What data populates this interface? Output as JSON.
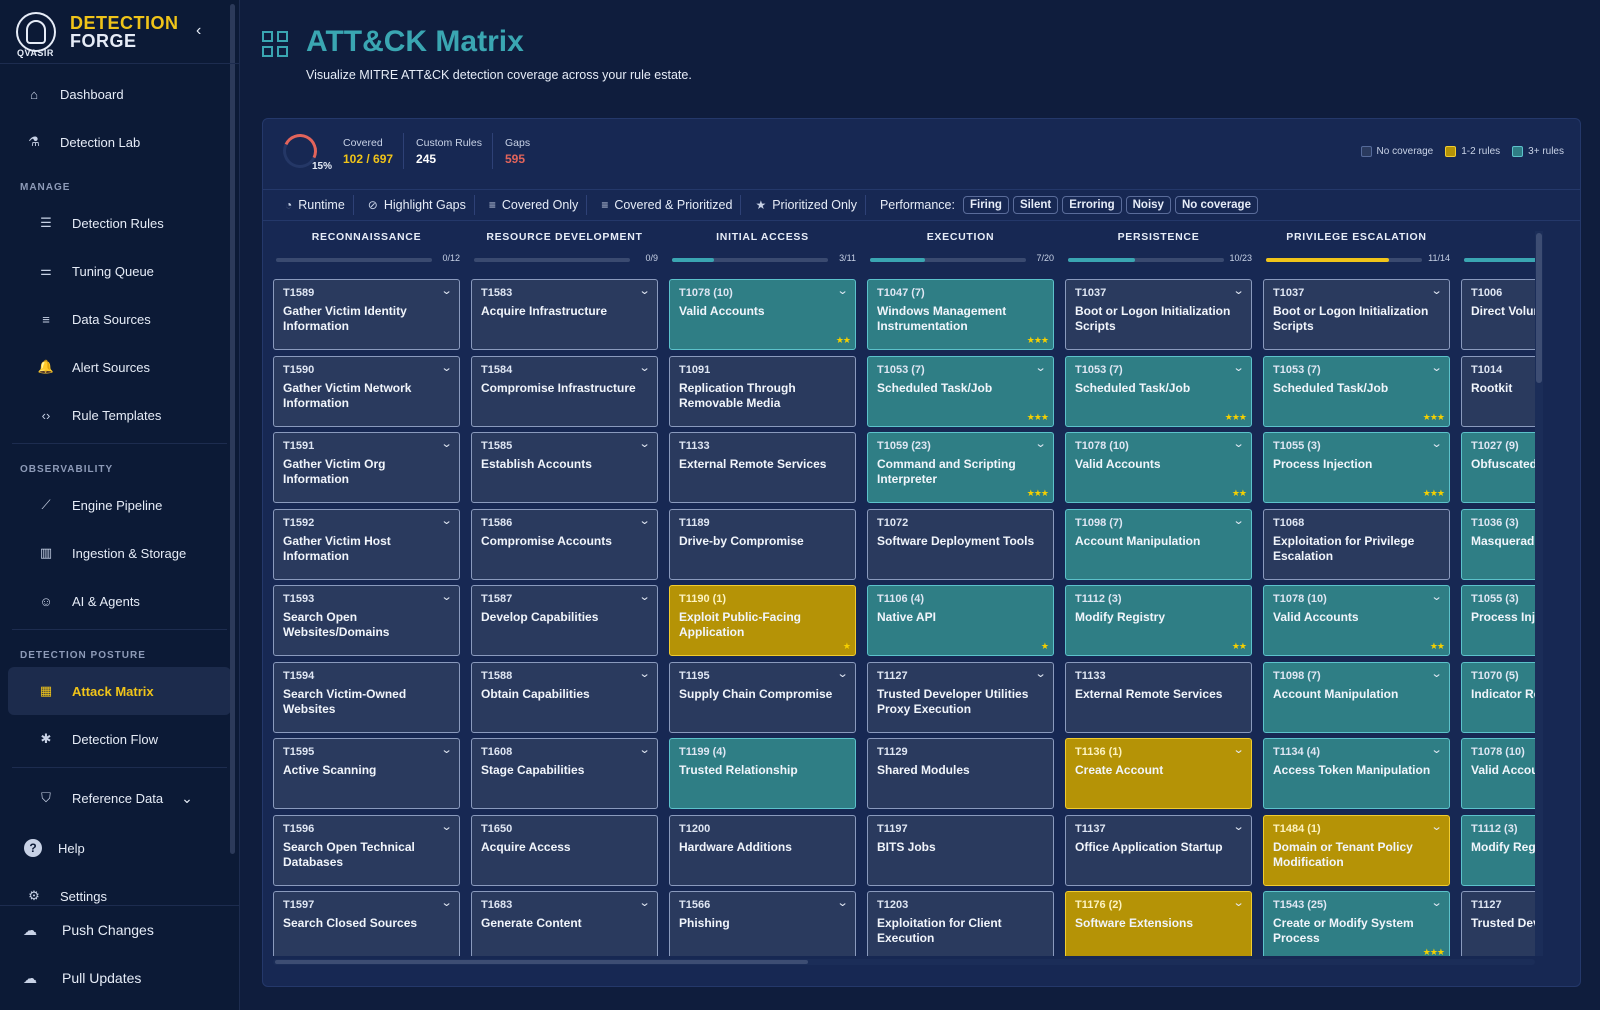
{
  "brand": {
    "line1": "DETECTION",
    "line2": "FORGE",
    "sub": "QVASIR",
    "collapse": "‹"
  },
  "nav": {
    "top": [
      {
        "key": "dashboard",
        "label": "Dashboard",
        "icon": "home-icon",
        "glyph": "⌂"
      },
      {
        "key": "detection-lab",
        "label": "Detection Lab",
        "icon": "microscope-icon",
        "glyph": "⚗"
      }
    ],
    "manage_title": "MANAGE",
    "manage": [
      {
        "key": "detection-rules",
        "label": "Detection Rules",
        "icon": "rules-icon",
        "glyph": "☰"
      },
      {
        "key": "tuning-queue",
        "label": "Tuning Queue",
        "icon": "tune-icon",
        "glyph": "⚌"
      },
      {
        "key": "data-sources",
        "label": "Data Sources",
        "icon": "list-icon",
        "glyph": "≡"
      },
      {
        "key": "alert-sources",
        "label": "Alert Sources",
        "icon": "bell-icon",
        "glyph": "🔔"
      },
      {
        "key": "rule-templates",
        "label": "Rule Templates",
        "icon": "code-icon",
        "glyph": "‹›"
      }
    ],
    "observability_title": "OBSERVABILITY",
    "observability": [
      {
        "key": "engine-pipeline",
        "label": "Engine Pipeline",
        "icon": "trend-icon",
        "glyph": "⟋"
      },
      {
        "key": "ingestion-storage",
        "label": "Ingestion & Storage",
        "icon": "bar-chart-icon",
        "glyph": "▥"
      },
      {
        "key": "ai-agents",
        "label": "AI & Agents",
        "icon": "robot-icon",
        "glyph": "☺"
      }
    ],
    "posture_title": "DETECTION POSTURE",
    "posture": [
      {
        "key": "attack-matrix",
        "label": "Attack Matrix",
        "icon": "grid-icon",
        "glyph": "▦",
        "active": true
      },
      {
        "key": "detection-flow",
        "label": "Detection Flow",
        "icon": "flow-icon",
        "glyph": "✱"
      }
    ],
    "reference": {
      "label": "Reference Data",
      "glyph": "⛉",
      "chevron": "⌄"
    },
    "help": {
      "label": "Help",
      "glyph": "?"
    },
    "settings": {
      "label": "Settings",
      "glyph": "⚙"
    },
    "push": {
      "label": "Push Changes",
      "glyph": "☁"
    },
    "pull": {
      "label": "Pull Updates",
      "glyph": "☁"
    }
  },
  "header": {
    "title": "ATT&CK Matrix",
    "subtitle": "Visualize MITRE ATT&CK detection coverage across your rule estate."
  },
  "stats": {
    "percent": "15%",
    "covered_label": "Covered",
    "covered_value": "102 / 697",
    "custom_label": "Custom Rules",
    "custom_value": "245",
    "gaps_label": "Gaps",
    "gaps_value": "595"
  },
  "legend": [
    {
      "label": "No coverage",
      "color": "#2a3a5e"
    },
    {
      "label": "1-2 rules",
      "color": "#b59306"
    },
    {
      "label": "3+ rules",
      "color": "#2f7e85"
    }
  ],
  "toolbar": {
    "runtime": "Runtime",
    "highlight_gaps": "Highlight Gaps",
    "covered_only": "Covered Only",
    "covered_prioritized": "Covered & Prioritized",
    "prioritized_only": "Prioritized Only",
    "performance_label": "Performance:",
    "chips": [
      "Firing",
      "Silent",
      "Erroring",
      "Noisy",
      "No coverage"
    ]
  },
  "colors": {
    "accent": "#3aa6b2",
    "brand": "#f0c419",
    "teal": "#2f7e85",
    "yellow": "#b59306",
    "gap": "#e2645b"
  },
  "tactics": [
    {
      "name": "RECONNAISSANCE",
      "count": "0/12",
      "progress": 0,
      "bar": "#3aa6b2",
      "cells": [
        {
          "id": "T1589",
          "name": "Gather Victim Identity Information",
          "s": "none",
          "chev": true
        },
        {
          "id": "T1590",
          "name": "Gather Victim Network Information",
          "s": "none",
          "chev": true
        },
        {
          "id": "T1591",
          "name": "Gather Victim Org Information",
          "s": "none",
          "chev": true
        },
        {
          "id": "T1592",
          "name": "Gather Victim Host Information",
          "s": "none",
          "chev": true
        },
        {
          "id": "T1593",
          "name": "Search Open Websites/Domains",
          "s": "none",
          "chev": true
        },
        {
          "id": "T1594",
          "name": "Search Victim-Owned Websites",
          "s": "none",
          "chev": false
        },
        {
          "id": "T1595",
          "name": "Active Scanning",
          "s": "none",
          "chev": true
        },
        {
          "id": "T1596",
          "name": "Search Open Technical Databases",
          "s": "none",
          "chev": true
        },
        {
          "id": "T1597",
          "name": "Search Closed Sources",
          "s": "none",
          "chev": true
        }
      ]
    },
    {
      "name": "RESOURCE DEVELOPMENT",
      "count": "0/9",
      "progress": 0,
      "bar": "#3aa6b2",
      "cells": [
        {
          "id": "T1583",
          "name": "Acquire Infrastructure",
          "s": "none",
          "chev": true
        },
        {
          "id": "T1584",
          "name": "Compromise Infrastructure",
          "s": "none",
          "chev": true
        },
        {
          "id": "T1585",
          "name": "Establish Accounts",
          "s": "none",
          "chev": true
        },
        {
          "id": "T1586",
          "name": "Compromise Accounts",
          "s": "none",
          "chev": true
        },
        {
          "id": "T1587",
          "name": "Develop Capabilities",
          "s": "none",
          "chev": true
        },
        {
          "id": "T1588",
          "name": "Obtain Capabilities",
          "s": "none",
          "chev": true
        },
        {
          "id": "T1608",
          "name": "Stage Capabilities",
          "s": "none",
          "chev": true
        },
        {
          "id": "T1650",
          "name": "Acquire Access",
          "s": "none",
          "chev": false
        },
        {
          "id": "T1683",
          "name": "Generate Content",
          "s": "none",
          "chev": true
        }
      ]
    },
    {
      "name": "INITIAL ACCESS",
      "count": "3/11",
      "progress": 0.27,
      "bar": "#3aa6b2",
      "cells": [
        {
          "id": "T1078 (10)",
          "name": "Valid Accounts",
          "s": "teal",
          "chev": true,
          "stars": "★★"
        },
        {
          "id": "T1091",
          "name": "Replication Through Removable Media",
          "s": "none",
          "chev": false
        },
        {
          "id": "T1133",
          "name": "External Remote Services",
          "s": "none",
          "chev": false
        },
        {
          "id": "T1189",
          "name": "Drive-by Compromise",
          "s": "none",
          "chev": false
        },
        {
          "id": "T1190 (1)",
          "name": "Exploit Public-Facing Application",
          "s": "yellow",
          "chev": false,
          "stars": "★"
        },
        {
          "id": "T1195",
          "name": "Supply Chain Compromise",
          "s": "none",
          "chev": true
        },
        {
          "id": "T1199 (4)",
          "name": "Trusted Relationship",
          "s": "teal",
          "chev": false
        },
        {
          "id": "T1200",
          "name": "Hardware Additions",
          "s": "none",
          "chev": false
        },
        {
          "id": "T1566",
          "name": "Phishing",
          "s": "none",
          "chev": true
        }
      ]
    },
    {
      "name": "EXECUTION",
      "count": "7/20",
      "progress": 0.35,
      "bar": "#3aa6b2",
      "cells": [
        {
          "id": "T1047 (7)",
          "name": "Windows Management Instrumentation",
          "s": "teal",
          "chev": false,
          "stars": "★★★"
        },
        {
          "id": "T1053 (7)",
          "name": "Scheduled Task/Job",
          "s": "teal",
          "chev": true,
          "stars": "★★★"
        },
        {
          "id": "T1059 (23)",
          "name": "Command and Scripting Interpreter",
          "s": "teal",
          "chev": true,
          "stars": "★★★"
        },
        {
          "id": "T1072",
          "name": "Software Deployment Tools",
          "s": "none",
          "chev": false
        },
        {
          "id": "T1106 (4)",
          "name": "Native API",
          "s": "teal",
          "chev": false,
          "stars": "★"
        },
        {
          "id": "T1127",
          "name": "Trusted Developer Utilities Proxy Execution",
          "s": "none",
          "chev": true
        },
        {
          "id": "T1129",
          "name": "Shared Modules",
          "s": "none",
          "chev": false
        },
        {
          "id": "T1197",
          "name": "BITS Jobs",
          "s": "none",
          "chev": false
        },
        {
          "id": "T1203",
          "name": "Exploitation for Client Execution",
          "s": "none",
          "chev": false
        }
      ]
    },
    {
      "name": "PERSISTENCE",
      "count": "10/23",
      "progress": 0.43,
      "bar": "#3aa6b2",
      "cells": [
        {
          "id": "T1037",
          "name": "Boot or Logon Initialization Scripts",
          "s": "none",
          "chev": true
        },
        {
          "id": "T1053 (7)",
          "name": "Scheduled Task/Job",
          "s": "teal",
          "chev": true,
          "stars": "★★★"
        },
        {
          "id": "T1078 (10)",
          "name": "Valid Accounts",
          "s": "teal",
          "chev": true,
          "stars": "★★"
        },
        {
          "id": "T1098 (7)",
          "name": "Account Manipulation",
          "s": "teal",
          "chev": true
        },
        {
          "id": "T1112 (3)",
          "name": "Modify Registry",
          "s": "teal",
          "chev": false,
          "stars": "★★"
        },
        {
          "id": "T1133",
          "name": "External Remote Services",
          "s": "none",
          "chev": false
        },
        {
          "id": "T1136 (1)",
          "name": "Create Account",
          "s": "yellow",
          "chev": true
        },
        {
          "id": "T1137",
          "name": "Office Application Startup",
          "s": "none",
          "chev": true
        },
        {
          "id": "T1176 (2)",
          "name": "Software Extensions",
          "s": "yellow",
          "chev": true
        }
      ]
    },
    {
      "name": "PRIVILEGE ESCALATION",
      "count": "11/14",
      "progress": 0.79,
      "bar": "#f0c419",
      "cells": [
        {
          "id": "T1037",
          "name": "Boot or Logon Initialization Scripts",
          "s": "none",
          "chev": true
        },
        {
          "id": "T1053 (7)",
          "name": "Scheduled Task/Job",
          "s": "teal",
          "chev": true,
          "stars": "★★★"
        },
        {
          "id": "T1055 (3)",
          "name": "Process Injection",
          "s": "teal",
          "chev": true,
          "stars": "★★★"
        },
        {
          "id": "T1068",
          "name": "Exploitation for Privilege Escalation",
          "s": "none",
          "chev": false
        },
        {
          "id": "T1078 (10)",
          "name": "Valid Accounts",
          "s": "teal",
          "chev": true,
          "stars": "★★"
        },
        {
          "id": "T1098 (7)",
          "name": "Account Manipulation",
          "s": "teal",
          "chev": true
        },
        {
          "id": "T1134 (4)",
          "name": "Access Token Manipulation",
          "s": "teal",
          "chev": true
        },
        {
          "id": "T1484 (1)",
          "name": "Domain or Tenant Policy Modification",
          "s": "yellow",
          "chev": true
        },
        {
          "id": "T1543 (25)",
          "name": "Create or Modify System Process",
          "s": "teal",
          "chev": true,
          "stars": "★★★"
        }
      ]
    },
    {
      "name": "S",
      "count": "",
      "progress": 0.5,
      "bar": "#3aa6b2",
      "cells": [
        {
          "id": "T1006",
          "name": "Direct Volum",
          "s": "none",
          "chev": false
        },
        {
          "id": "T1014",
          "name": "Rootkit",
          "s": "none",
          "chev": false
        },
        {
          "id": "T1027 (9)",
          "name": "Obfuscated I",
          "s": "teal",
          "chev": false
        },
        {
          "id": "T1036 (3)",
          "name": "Masqueradin",
          "s": "teal",
          "chev": false
        },
        {
          "id": "T1055 (3)",
          "name": "Process Inje",
          "s": "teal",
          "chev": false
        },
        {
          "id": "T1070 (5)",
          "name": "Indicator Re",
          "s": "teal",
          "chev": false
        },
        {
          "id": "T1078 (10)",
          "name": "Valid Accour",
          "s": "teal",
          "chev": false
        },
        {
          "id": "T1112 (3)",
          "name": "Modify Regis",
          "s": "teal",
          "chev": false
        },
        {
          "id": "T1127",
          "name": "Trusted Deve Proxy Execut",
          "s": "none",
          "chev": false
        }
      ]
    }
  ]
}
